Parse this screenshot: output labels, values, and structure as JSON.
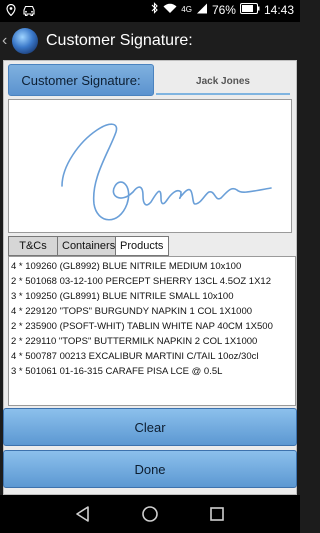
{
  "status_bar": {
    "network_label": "4G",
    "battery_percent": "76%",
    "time": "14:43",
    "icons": [
      "location-icon",
      "car-icon",
      "bluetooth-icon",
      "wifi-icon",
      "cellular-signal-icon",
      "battery-icon"
    ]
  },
  "action_bar": {
    "title": "Customer Signature:"
  },
  "signature": {
    "label": "Customer Signature:",
    "name_value": "Jack Jones",
    "ink_color": "#6a9fd8"
  },
  "tabs": [
    {
      "label": "T&Cs",
      "active": false
    },
    {
      "label": "Containers",
      "active": false
    },
    {
      "label": "Products",
      "active": true
    }
  ],
  "products": [
    "4 * 109260 (GL8992) BLUE NITRILE MEDIUM 10x100",
    "2 * 501068 03-12-100 PERCEPT SHERRY 13CL 4.5OZ 1X12",
    "3 * 109250 (GL8991) BLUE NITRILE SMALL 10x100",
    "4 * 229120 \"TOPS\" BURGUNDY NAPKIN 1 COL 1X1000",
    "2 * 235900 (PSOFT-WHIT) TABLIN WHITE NAP 40CM 1X500",
    "2 * 229110 \"TOPS\" BUTTERMILK NAPKIN 2 COL 1X1000",
    "4 * 500787 00213 EXCALIBUR MARTINI C/TAIL 10oz/30cl",
    "3 * 501061 01-16-315 CARAFE PISA LCE @ 0.5L"
  ],
  "buttons": {
    "clear": "Clear",
    "done": "Done"
  },
  "colors": {
    "button_blue": "#6fa6dc",
    "accent_underline": "#7fb4e0"
  }
}
